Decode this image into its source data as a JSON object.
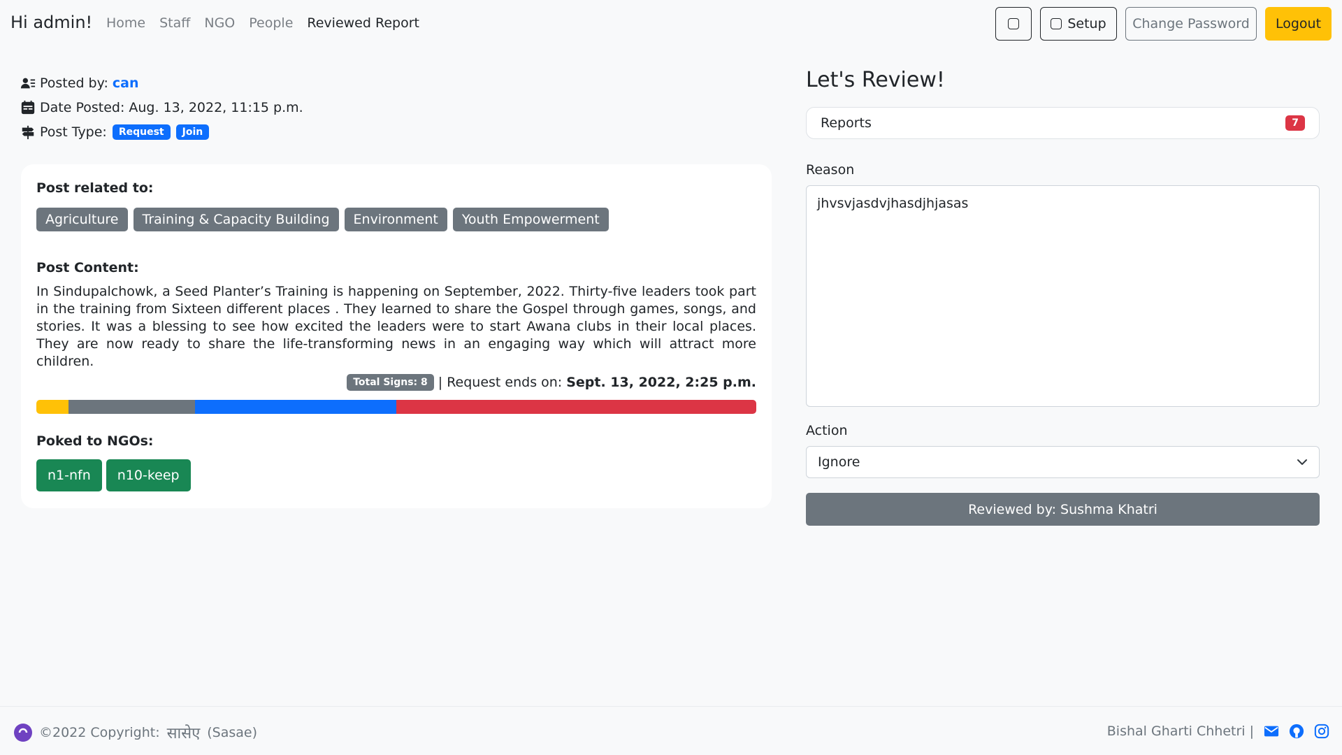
{
  "navbar": {
    "greeting": "Hi admin!",
    "links": [
      "Home",
      "Staff",
      "NGO",
      "People",
      "Reviewed Report"
    ],
    "setup_label": "Setup",
    "change_password_label": "Change Password",
    "logout_label": "Logout"
  },
  "post": {
    "posted_by_label": "Posted by:",
    "posted_by_user": "can",
    "date_label": "Date Posted: Aug. 13, 2022, 11:15 p.m.",
    "type_label": "Post Type:",
    "types": [
      "Request",
      "Join"
    ],
    "related_heading": "Post related to:",
    "tags": [
      "Agriculture",
      "Training & Capacity Building",
      "Environment",
      "Youth Empowerment"
    ],
    "content_heading": "Post Content:",
    "content": "In Sindupalchowk, a Seed Planter’s Training is happening on September, 2022. Thirty-five leaders took part in the training from Sixteen different places . They learned to share the Gospel through games, songs, and stories. It was a blessing to see how excited the leaders were to start Awana clubs in their local places. They are now ready to share the life-transforming news in an engaging way which will attract more children.",
    "total_signs": "Total Signs: 8",
    "request_ends_label": "| Request ends on:",
    "request_ends_value": "Sept. 13, 2022, 2:25 p.m.",
    "progress_segments": [
      {
        "color": "#ffc107",
        "fraction": 0.045
      },
      {
        "color": "#6c757d",
        "fraction": 0.175
      },
      {
        "color": "#0d6efd",
        "fraction": 0.28
      },
      {
        "color": "#dc3545",
        "fraction": 0.5
      }
    ],
    "poked_heading": "Poked to NGOs:",
    "ngos": [
      "n1-nfn",
      "n10-keep"
    ]
  },
  "review": {
    "title": "Let's Review!",
    "reports_label": "Reports",
    "reports_count": "7",
    "reason_label": "Reason",
    "reason_value": "jhvsvjasdvjhasdjhjasas",
    "action_label": "Action",
    "action_value": "Ignore",
    "reviewed_by": "Reviewed by: Sushma Khatri"
  },
  "footer": {
    "copyright": "©2022 Copyright:",
    "brand": "सासेए",
    "brand_latin": "(Sasae)",
    "author": "Bishal Gharti Chhetri |"
  }
}
